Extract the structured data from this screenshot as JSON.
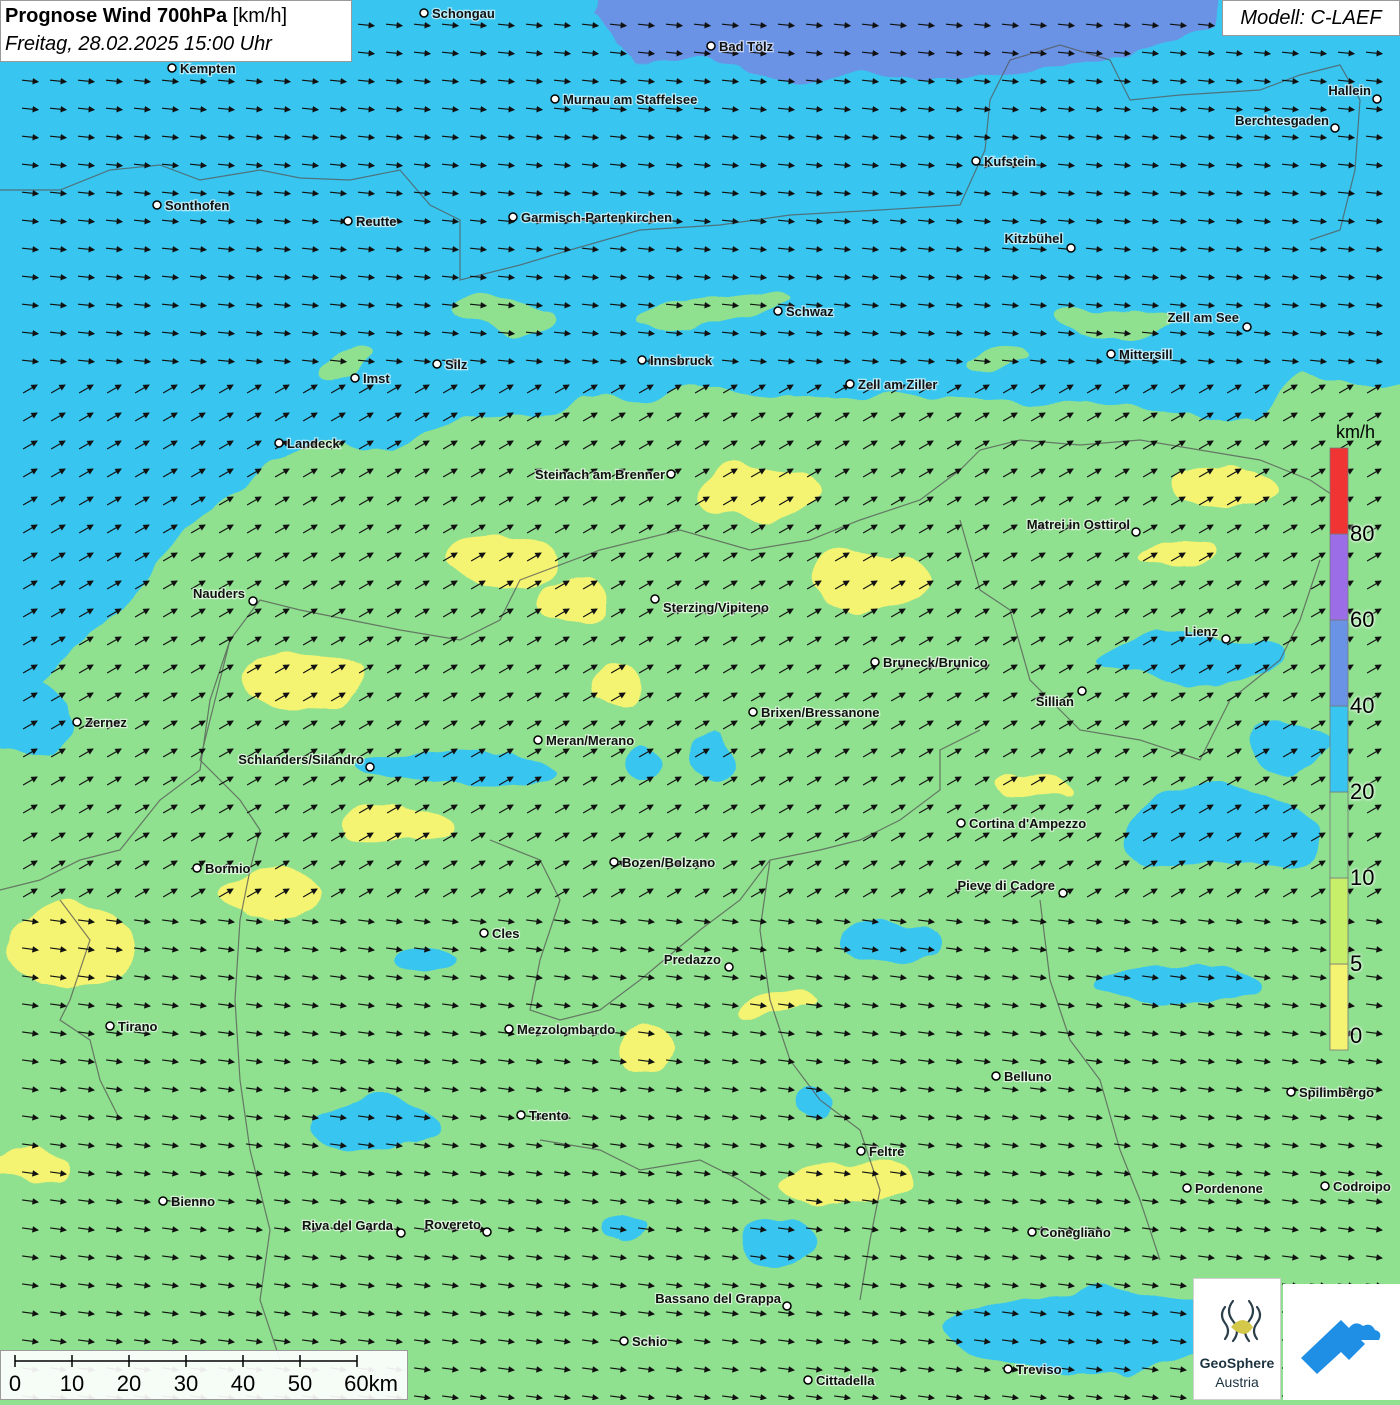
{
  "header": {
    "title_bold": "Prognose Wind 700hPa",
    "title_unit": "[km/h]",
    "datetime": "Freitag, 28.02.2025 15:00 Uhr",
    "model": "Modell: C-LAEF"
  },
  "legend": {
    "unit": "km/h",
    "bins": [
      {
        "from": 0,
        "to": 5,
        "color": "#f4f472"
      },
      {
        "from": 5,
        "to": 10,
        "color": "#c8ef6a"
      },
      {
        "from": 10,
        "to": 20,
        "color": "#8fe08f"
      },
      {
        "from": 20,
        "to": 40,
        "color": "#38c6f0"
      },
      {
        "from": 40,
        "to": 60,
        "color": "#6a93e6"
      },
      {
        "from": 60,
        "to": 80,
        "color": "#9b6ee8"
      },
      {
        "from": 80,
        "to": 100,
        "color": "#f03434"
      }
    ],
    "labels": [
      "0",
      "5",
      "10",
      "20",
      "40",
      "60",
      "80"
    ]
  },
  "scalebar": {
    "labels": [
      "0",
      "10",
      "20",
      "30",
      "40",
      "50",
      "60km"
    ]
  },
  "cities": [
    {
      "name": "Schongau"
    },
    {
      "name": "Bad Tölz"
    },
    {
      "name": "Kempten"
    },
    {
      "name": "Murnau am Staffelsee"
    },
    {
      "name": "Hallein"
    },
    {
      "name": "Berchtesgaden"
    },
    {
      "name": "Kufstein"
    },
    {
      "name": "Sonthofen"
    },
    {
      "name": "Reutte"
    },
    {
      "name": "Garmisch-Partenkirchen"
    },
    {
      "name": "Kitzbühel"
    },
    {
      "name": "Schwaz"
    },
    {
      "name": "Zell am See"
    },
    {
      "name": "Innsbruck"
    },
    {
      "name": "Mittersill"
    },
    {
      "name": "Imst"
    },
    {
      "name": "Silz"
    },
    {
      "name": "Zell am Ziller"
    },
    {
      "name": "Landeck"
    },
    {
      "name": "Steinach am Brenner"
    },
    {
      "name": "Matrei in Osttirol"
    },
    {
      "name": "Nauders"
    },
    {
      "name": "Sterzing/Vipiteno"
    },
    {
      "name": "Lienz"
    },
    {
      "name": "Bruneck/Brunico"
    },
    {
      "name": "Sillian"
    },
    {
      "name": "Zernez"
    },
    {
      "name": "Brixen/Bressanone"
    },
    {
      "name": "Meran/Merano"
    },
    {
      "name": "Schlanders/Silandro"
    },
    {
      "name": "Cortina d'Ampezzo"
    },
    {
      "name": "Bozen/Bolzano"
    },
    {
      "name": "Bormio"
    },
    {
      "name": "Pieve di Cadore"
    },
    {
      "name": "Cles"
    },
    {
      "name": "Predazzo"
    },
    {
      "name": "Tirano"
    },
    {
      "name": "Mezzolombardo"
    },
    {
      "name": "Belluno"
    },
    {
      "name": "Spilimbergo"
    },
    {
      "name": "Trento"
    },
    {
      "name": "Feltre"
    },
    {
      "name": "Bienno"
    },
    {
      "name": "Pordenone"
    },
    {
      "name": "Codroipo"
    },
    {
      "name": "Riva del Garda"
    },
    {
      "name": "Rovereto"
    },
    {
      "name": "Conegliano"
    },
    {
      "name": "Bassano del Grappa"
    },
    {
      "name": "Schio"
    },
    {
      "name": "Treviso"
    },
    {
      "name": "Cittadella"
    }
  ],
  "logo": {
    "line1": "GeoSphere",
    "line2": "Austria"
  },
  "colors": {
    "wind_low": "#f4f472",
    "wind_mid": "#8fe08f",
    "wind_high": "#38c6f0",
    "wind_very_high": "#6a93e6",
    "border": "#555555",
    "logo_blue": "#1f8fe6"
  }
}
